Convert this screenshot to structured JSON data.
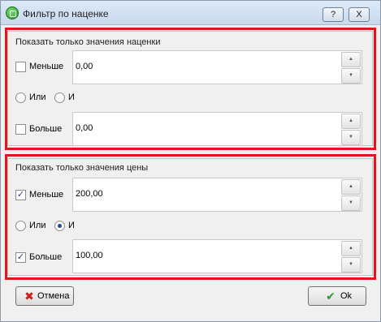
{
  "window": {
    "title": "Фильтр по наценке",
    "help_label": "?",
    "close_label": "X",
    "annotation_color": "#e0161c"
  },
  "markup_group": {
    "title": "Показать только значения наценки",
    "less": {
      "checked": false,
      "label": "Меньше",
      "value": "0,00"
    },
    "logic": {
      "or_label": "Или",
      "and_label": "И",
      "selected": "none"
    },
    "greater": {
      "checked": false,
      "label": "Больше",
      "value": "0,00"
    }
  },
  "price_group": {
    "title": "Показать только значения цены",
    "less": {
      "checked": true,
      "check_mark": "✓",
      "label": "Меньше",
      "value": "200,00"
    },
    "logic": {
      "or_label": "Или",
      "and_label": "И",
      "selected": "and"
    },
    "greater": {
      "checked": true,
      "check_mark": "✓",
      "label": "Больше",
      "value": "100,00"
    }
  },
  "spin": {
    "up_glyph": "▲",
    "down_glyph": "▼"
  },
  "buttons": {
    "cancel_label": "Отмена",
    "cancel_icon": "✖",
    "ok_label": "Ok",
    "ok_icon": "✔"
  }
}
